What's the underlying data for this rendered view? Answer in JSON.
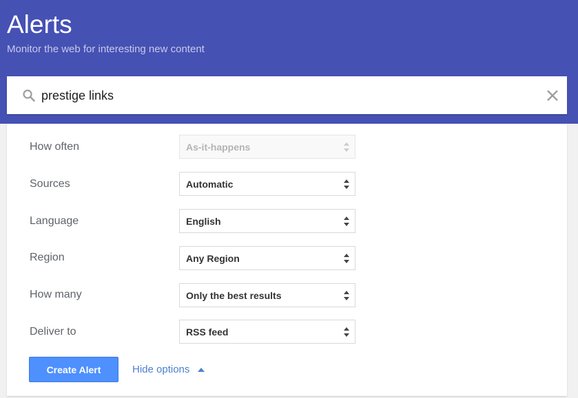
{
  "header": {
    "title": "Alerts",
    "subtitle": "Monitor the web for interesting new content",
    "background_color": "#4651b4"
  },
  "search": {
    "value": "prestige links",
    "search_icon": "search-icon",
    "clear_icon": "close-icon"
  },
  "options": {
    "rows": [
      {
        "label": "How often",
        "value": "As-it-happens",
        "disabled": true
      },
      {
        "label": "Sources",
        "value": "Automatic",
        "disabled": false
      },
      {
        "label": "Language",
        "value": "English",
        "disabled": false
      },
      {
        "label": "Region",
        "value": "Any Region",
        "disabled": false
      },
      {
        "label": "How many",
        "value": "Only the best results",
        "disabled": false
      },
      {
        "label": "Deliver to",
        "value": "RSS feed",
        "disabled": false
      }
    ]
  },
  "actions": {
    "create_label": "Create Alert",
    "create_color": "#4d90fe",
    "hide_options_label": "Hide options",
    "hide_options_icon": "caret-up-icon",
    "link_color": "#4d80cf"
  }
}
